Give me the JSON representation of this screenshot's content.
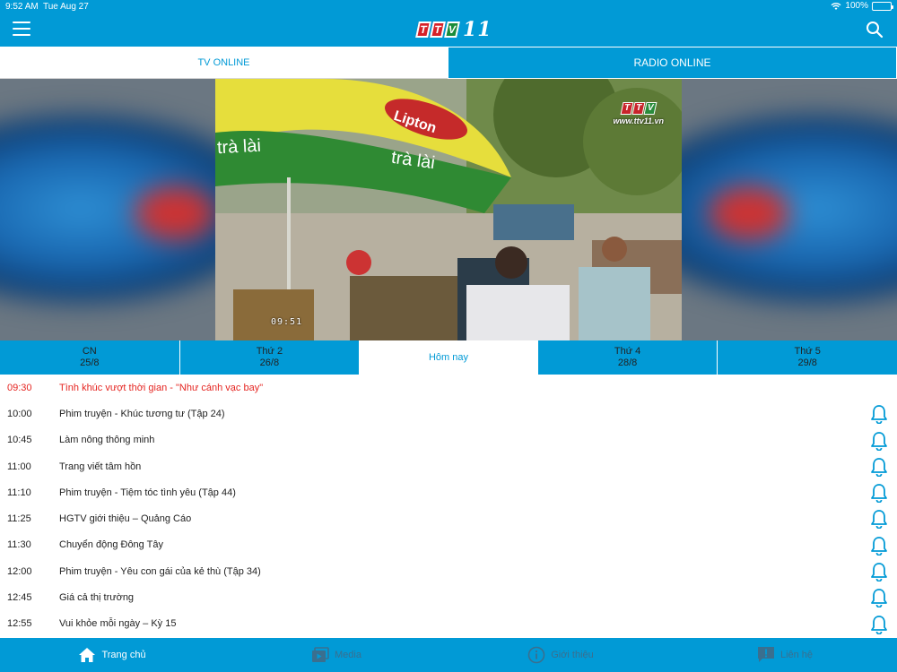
{
  "status_bar": {
    "time": "9:52 AM",
    "date": "Tue Aug 27",
    "battery": "100%"
  },
  "header": {
    "menu_icon": "hamburger-icon",
    "search_icon": "search-icon",
    "logo_letters": [
      "T",
      "T",
      "V"
    ],
    "logo_number": "11"
  },
  "tabs": [
    {
      "label": "TV ONLINE",
      "active": true
    },
    {
      "label": "RADIO ONLINE",
      "active": false
    }
  ],
  "player": {
    "channel_letters": [
      "T",
      "T",
      "V"
    ],
    "channel_url": "www.ttv11.vn",
    "timestamp": "09:51",
    "sign_brand": "Lipton",
    "sign_text": "trà lài"
  },
  "days": [
    {
      "name": "CN",
      "date": "25/8"
    },
    {
      "name": "Thứ 2",
      "date": "26/8"
    },
    {
      "name": "Hôm nay",
      "date": "",
      "today": true
    },
    {
      "name": "Thứ 4",
      "date": "28/8"
    },
    {
      "name": "Thứ 5",
      "date": "29/8"
    }
  ],
  "schedule": [
    {
      "time": "09:30",
      "title": "Tình khúc vượt thời gian - \"Như cánh vạc bay\"",
      "live": true
    },
    {
      "time": "10:00",
      "title": "Phim truyện - Khúc tương tư (Tập 24)"
    },
    {
      "time": "10:45",
      "title": "Làm nông thông minh"
    },
    {
      "time": "11:00",
      "title": "Trang viết tâm hồn"
    },
    {
      "time": "11:10",
      "title": "Phim truyện - Tiệm tóc tình yêu (Tập 44)"
    },
    {
      "time": "11:25",
      "title": "HGTV giới thiệu – Quảng Cáo"
    },
    {
      "time": "11:30",
      "title": "Chuyển động Đông Tây"
    },
    {
      "time": "12:00",
      "title": "Phim truyện - Yêu con gái của kẻ thù (Tập 34)"
    },
    {
      "time": "12:45",
      "title": "Giá cả thị trường"
    },
    {
      "time": "12:55",
      "title": "Vui khỏe mỗi ngày – Kỳ 15"
    }
  ],
  "bottom_nav": [
    {
      "label": "Trang chủ",
      "icon": "home-icon",
      "active": true
    },
    {
      "label": "Media",
      "icon": "media-icon"
    },
    {
      "label": "Giới thiệu",
      "icon": "info-icon"
    },
    {
      "label": "Liên hệ",
      "icon": "contact-icon"
    }
  ],
  "colors": {
    "primary": "#019ad6",
    "live": "#e52521",
    "inactive_nav": "#3a6f8f"
  }
}
